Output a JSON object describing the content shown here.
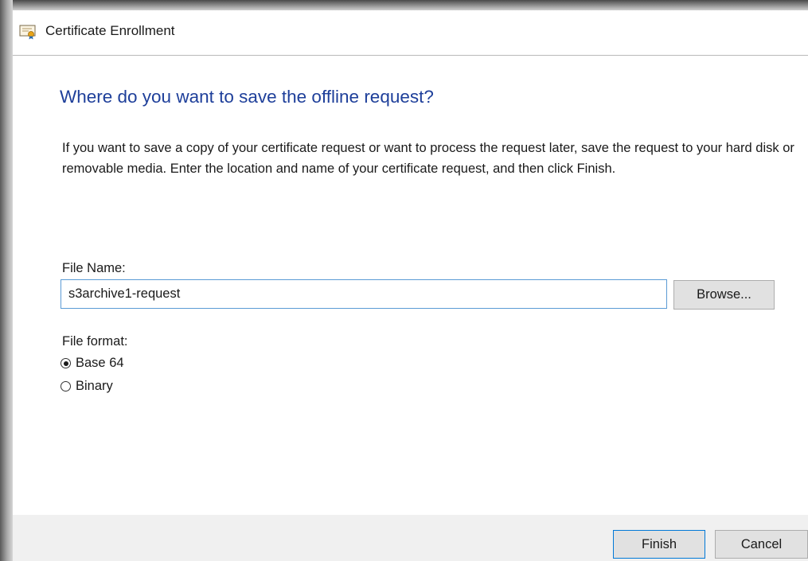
{
  "window": {
    "title": "Certificate Enrollment",
    "icon": "certificate-icon"
  },
  "page": {
    "heading": "Where do you want to save the offline request?",
    "description": "If you want to save a copy of your certificate request or want to process the request later, save the request to your hard disk or removable media. Enter the location and name of your certificate request, and then click Finish."
  },
  "file_name": {
    "label": "File Name:",
    "value": "s3archive1-request",
    "browse_label": "Browse..."
  },
  "file_format": {
    "label": "File format:",
    "options": [
      {
        "label": "Base 64",
        "selected": true
      },
      {
        "label": "Binary",
        "selected": false
      }
    ]
  },
  "footer": {
    "finish_label": "Finish",
    "cancel_label": "Cancel"
  },
  "colors": {
    "heading": "#1e3f9a",
    "focus_border": "#5b9bd5",
    "default_button_border": "#0078d7",
    "footer_background": "#f0f0f0"
  }
}
